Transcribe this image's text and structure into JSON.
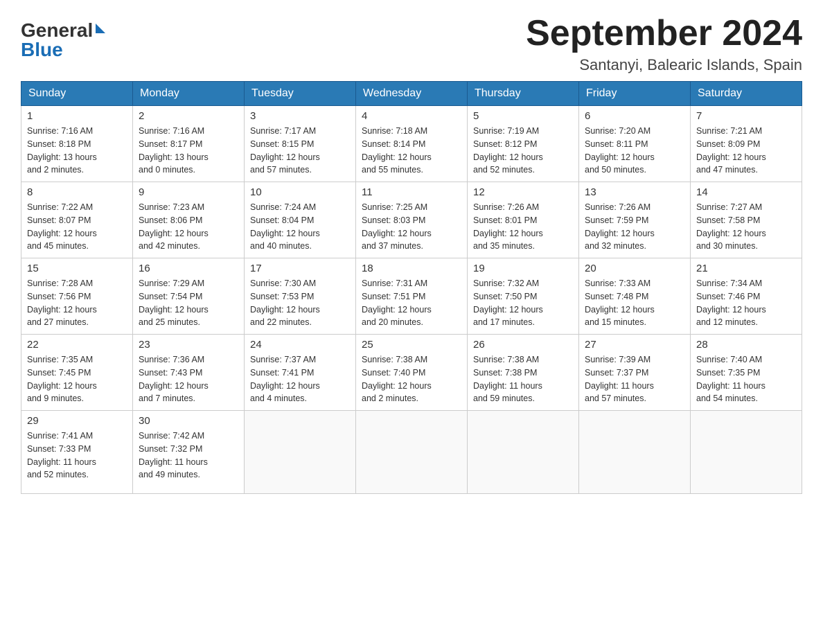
{
  "title": "September 2024",
  "subtitle": "Santanyi, Balearic Islands, Spain",
  "logo": {
    "general": "General",
    "blue": "Blue"
  },
  "headers": [
    "Sunday",
    "Monday",
    "Tuesday",
    "Wednesday",
    "Thursday",
    "Friday",
    "Saturday"
  ],
  "weeks": [
    [
      {
        "day": "1",
        "info": "Sunrise: 7:16 AM\nSunset: 8:18 PM\nDaylight: 13 hours\nand 2 minutes."
      },
      {
        "day": "2",
        "info": "Sunrise: 7:16 AM\nSunset: 8:17 PM\nDaylight: 13 hours\nand 0 minutes."
      },
      {
        "day": "3",
        "info": "Sunrise: 7:17 AM\nSunset: 8:15 PM\nDaylight: 12 hours\nand 57 minutes."
      },
      {
        "day": "4",
        "info": "Sunrise: 7:18 AM\nSunset: 8:14 PM\nDaylight: 12 hours\nand 55 minutes."
      },
      {
        "day": "5",
        "info": "Sunrise: 7:19 AM\nSunset: 8:12 PM\nDaylight: 12 hours\nand 52 minutes."
      },
      {
        "day": "6",
        "info": "Sunrise: 7:20 AM\nSunset: 8:11 PM\nDaylight: 12 hours\nand 50 minutes."
      },
      {
        "day": "7",
        "info": "Sunrise: 7:21 AM\nSunset: 8:09 PM\nDaylight: 12 hours\nand 47 minutes."
      }
    ],
    [
      {
        "day": "8",
        "info": "Sunrise: 7:22 AM\nSunset: 8:07 PM\nDaylight: 12 hours\nand 45 minutes."
      },
      {
        "day": "9",
        "info": "Sunrise: 7:23 AM\nSunset: 8:06 PM\nDaylight: 12 hours\nand 42 minutes."
      },
      {
        "day": "10",
        "info": "Sunrise: 7:24 AM\nSunset: 8:04 PM\nDaylight: 12 hours\nand 40 minutes."
      },
      {
        "day": "11",
        "info": "Sunrise: 7:25 AM\nSunset: 8:03 PM\nDaylight: 12 hours\nand 37 minutes."
      },
      {
        "day": "12",
        "info": "Sunrise: 7:26 AM\nSunset: 8:01 PM\nDaylight: 12 hours\nand 35 minutes."
      },
      {
        "day": "13",
        "info": "Sunrise: 7:26 AM\nSunset: 7:59 PM\nDaylight: 12 hours\nand 32 minutes."
      },
      {
        "day": "14",
        "info": "Sunrise: 7:27 AM\nSunset: 7:58 PM\nDaylight: 12 hours\nand 30 minutes."
      }
    ],
    [
      {
        "day": "15",
        "info": "Sunrise: 7:28 AM\nSunset: 7:56 PM\nDaylight: 12 hours\nand 27 minutes."
      },
      {
        "day": "16",
        "info": "Sunrise: 7:29 AM\nSunset: 7:54 PM\nDaylight: 12 hours\nand 25 minutes."
      },
      {
        "day": "17",
        "info": "Sunrise: 7:30 AM\nSunset: 7:53 PM\nDaylight: 12 hours\nand 22 minutes."
      },
      {
        "day": "18",
        "info": "Sunrise: 7:31 AM\nSunset: 7:51 PM\nDaylight: 12 hours\nand 20 minutes."
      },
      {
        "day": "19",
        "info": "Sunrise: 7:32 AM\nSunset: 7:50 PM\nDaylight: 12 hours\nand 17 minutes."
      },
      {
        "day": "20",
        "info": "Sunrise: 7:33 AM\nSunset: 7:48 PM\nDaylight: 12 hours\nand 15 minutes."
      },
      {
        "day": "21",
        "info": "Sunrise: 7:34 AM\nSunset: 7:46 PM\nDaylight: 12 hours\nand 12 minutes."
      }
    ],
    [
      {
        "day": "22",
        "info": "Sunrise: 7:35 AM\nSunset: 7:45 PM\nDaylight: 12 hours\nand 9 minutes."
      },
      {
        "day": "23",
        "info": "Sunrise: 7:36 AM\nSunset: 7:43 PM\nDaylight: 12 hours\nand 7 minutes."
      },
      {
        "day": "24",
        "info": "Sunrise: 7:37 AM\nSunset: 7:41 PM\nDaylight: 12 hours\nand 4 minutes."
      },
      {
        "day": "25",
        "info": "Sunrise: 7:38 AM\nSunset: 7:40 PM\nDaylight: 12 hours\nand 2 minutes."
      },
      {
        "day": "26",
        "info": "Sunrise: 7:38 AM\nSunset: 7:38 PM\nDaylight: 11 hours\nand 59 minutes."
      },
      {
        "day": "27",
        "info": "Sunrise: 7:39 AM\nSunset: 7:37 PM\nDaylight: 11 hours\nand 57 minutes."
      },
      {
        "day": "28",
        "info": "Sunrise: 7:40 AM\nSunset: 7:35 PM\nDaylight: 11 hours\nand 54 minutes."
      }
    ],
    [
      {
        "day": "29",
        "info": "Sunrise: 7:41 AM\nSunset: 7:33 PM\nDaylight: 11 hours\nand 52 minutes."
      },
      {
        "day": "30",
        "info": "Sunrise: 7:42 AM\nSunset: 7:32 PM\nDaylight: 11 hours\nand 49 minutes."
      },
      {
        "day": "",
        "info": ""
      },
      {
        "day": "",
        "info": ""
      },
      {
        "day": "",
        "info": ""
      },
      {
        "day": "",
        "info": ""
      },
      {
        "day": "",
        "info": ""
      }
    ]
  ]
}
